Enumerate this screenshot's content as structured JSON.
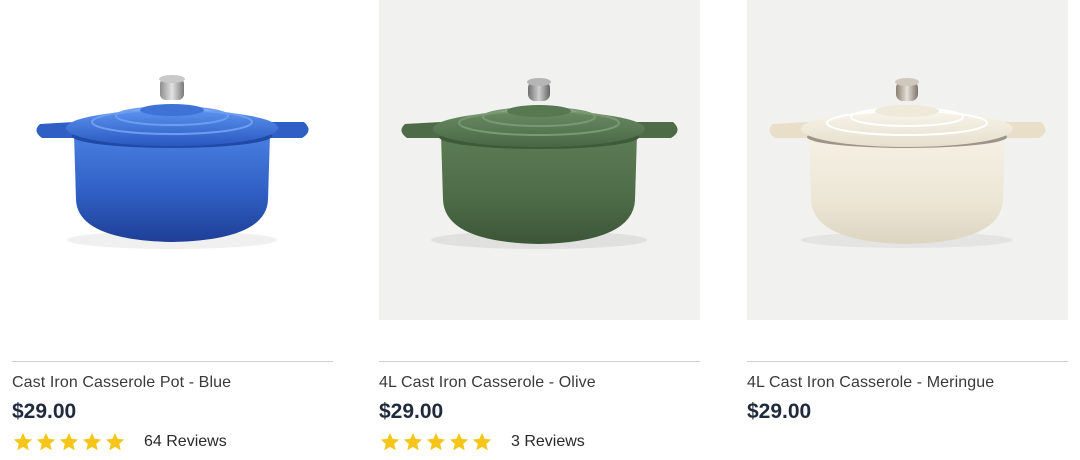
{
  "products": [
    {
      "title": "Cast Iron Casserole Pot - Blue",
      "price": "$29.00",
      "rating": 5,
      "reviews": "64 Reviews",
      "image": "blue-casserole-pot-image",
      "color": "#2f5fc4",
      "background": "#ffffff"
    },
    {
      "title": "4L Cast Iron Casserole - Olive",
      "price": "$29.00",
      "rating": 5,
      "reviews": "3 Reviews",
      "image": "olive-casserole-pot-image",
      "color": "#4d6b47",
      "background": "#f1f1ef"
    },
    {
      "title": "4L Cast Iron Casserole - Meringue",
      "price": "$29.00",
      "image": "meringue-casserole-pot-image",
      "color": "#ece6d6",
      "background": "#f1f1ef"
    }
  ],
  "colors": {
    "star": "#f5c518",
    "price": "#1f2a3c",
    "divider": "#cfcfcf"
  }
}
